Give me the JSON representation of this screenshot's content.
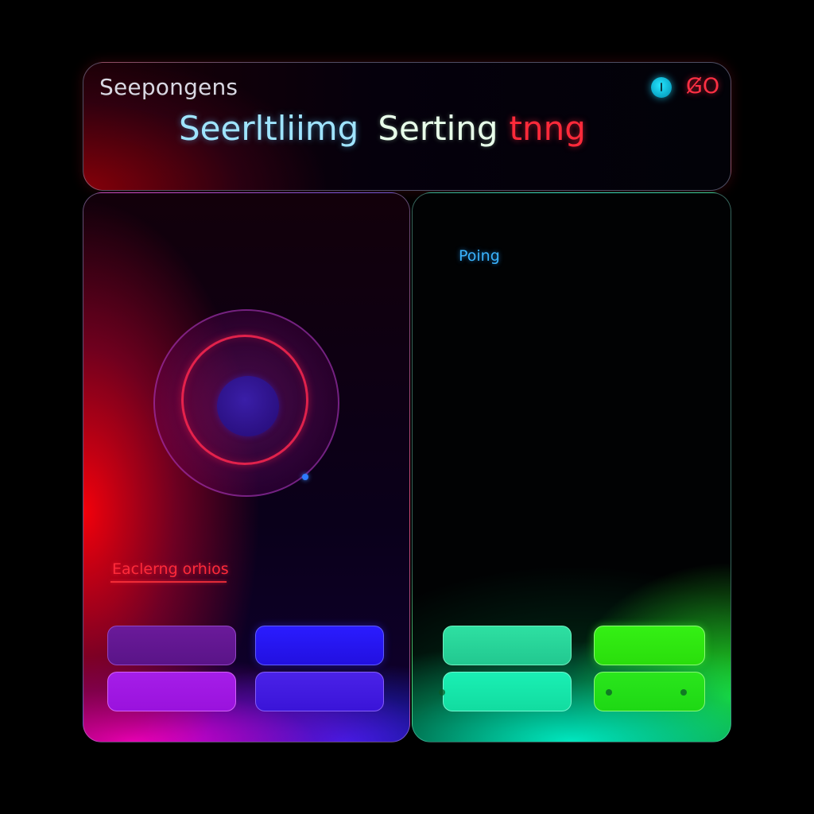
{
  "header": {
    "caption": "Seepongens",
    "title_part1": "Seerltliimg",
    "title_part2": "Serting",
    "title_part3": "tnng",
    "go_label": "G̸O"
  },
  "left_panel": {
    "label": "Eaclerng orhios"
  },
  "right_panel": {
    "label": "Poing"
  },
  "icons": {
    "status": "status-dot-icon",
    "dial": "dial-control"
  },
  "colors": {
    "accent_red": "#ff2a3a",
    "accent_cyan": "#26e6ff",
    "accent_blue": "#3ab4ff",
    "accent_green": "#34f014",
    "accent_magenta": "#a51ee8"
  }
}
